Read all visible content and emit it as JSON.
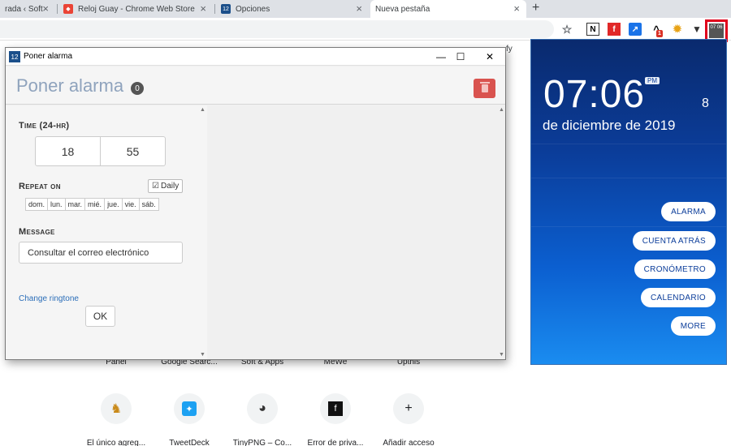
{
  "browser": {
    "tabs": [
      {
        "label": "rada ‹ Soft"
      },
      {
        "label": "Reloj Guay - Chrome Web Store"
      },
      {
        "label": "Opciones"
      },
      {
        "label": "Nueva pestaña"
      }
    ],
    "toolbar_icons": [
      "star-icon",
      "notion-icon",
      "flipboard-icon",
      "chart-icon",
      "arrow-icon",
      "gear-icon",
      "shield-icon"
    ],
    "notification_badge": "1",
    "bookmarks": [
      "fy"
    ],
    "clock_extension_icon": "07 06"
  },
  "shortcuts_row1": [
    "Panel",
    "Google Searc...",
    "Soft & Apps",
    "MeWe",
    "Upthis"
  ],
  "shortcuts_row2": [
    {
      "label": "El único agreg...",
      "icon": "tiger-icon"
    },
    {
      "label": "TweetDeck",
      "icon": "tweetdeck-icon"
    },
    {
      "label": "TinyPNG – Co...",
      "icon": "panda-icon"
    },
    {
      "label": "Error de priva...",
      "icon": "flipboard-icon"
    },
    {
      "label": "Añadir acceso",
      "icon": "plus-icon"
    }
  ],
  "dialog": {
    "window_title": "Poner alarma",
    "window_buttons": {
      "minimize": "—",
      "maximize": "☐",
      "close": "✕"
    },
    "header_title": "Poner alarma",
    "alarm_count": "0",
    "time_label": "Time (24-hr)",
    "hour": "18",
    "minute": "55",
    "repeat_label": "Repeat on",
    "daily_label": "Daily",
    "days": [
      "dom.",
      "lun.",
      "mar.",
      "mié.",
      "jue.",
      "vie.",
      "sáb."
    ],
    "message_label": "Message",
    "message_value": "Consultar el correo electrónico",
    "ringtone_link": "Change ringtone",
    "ok_label": "OK"
  },
  "clock": {
    "time": "07:06",
    "ampm": "PM",
    "day_number": "8",
    "date": "de diciembre de 2019",
    "buttons": [
      "ALARMA",
      "CUENTA ATRÁS",
      "CRONÓMETRO",
      "CALENDARIO",
      "MORE"
    ],
    "colors": {
      "top": "#0a2a6e",
      "bottom": "#1a8cf0",
      "highlight_border": "#e0001b"
    }
  }
}
